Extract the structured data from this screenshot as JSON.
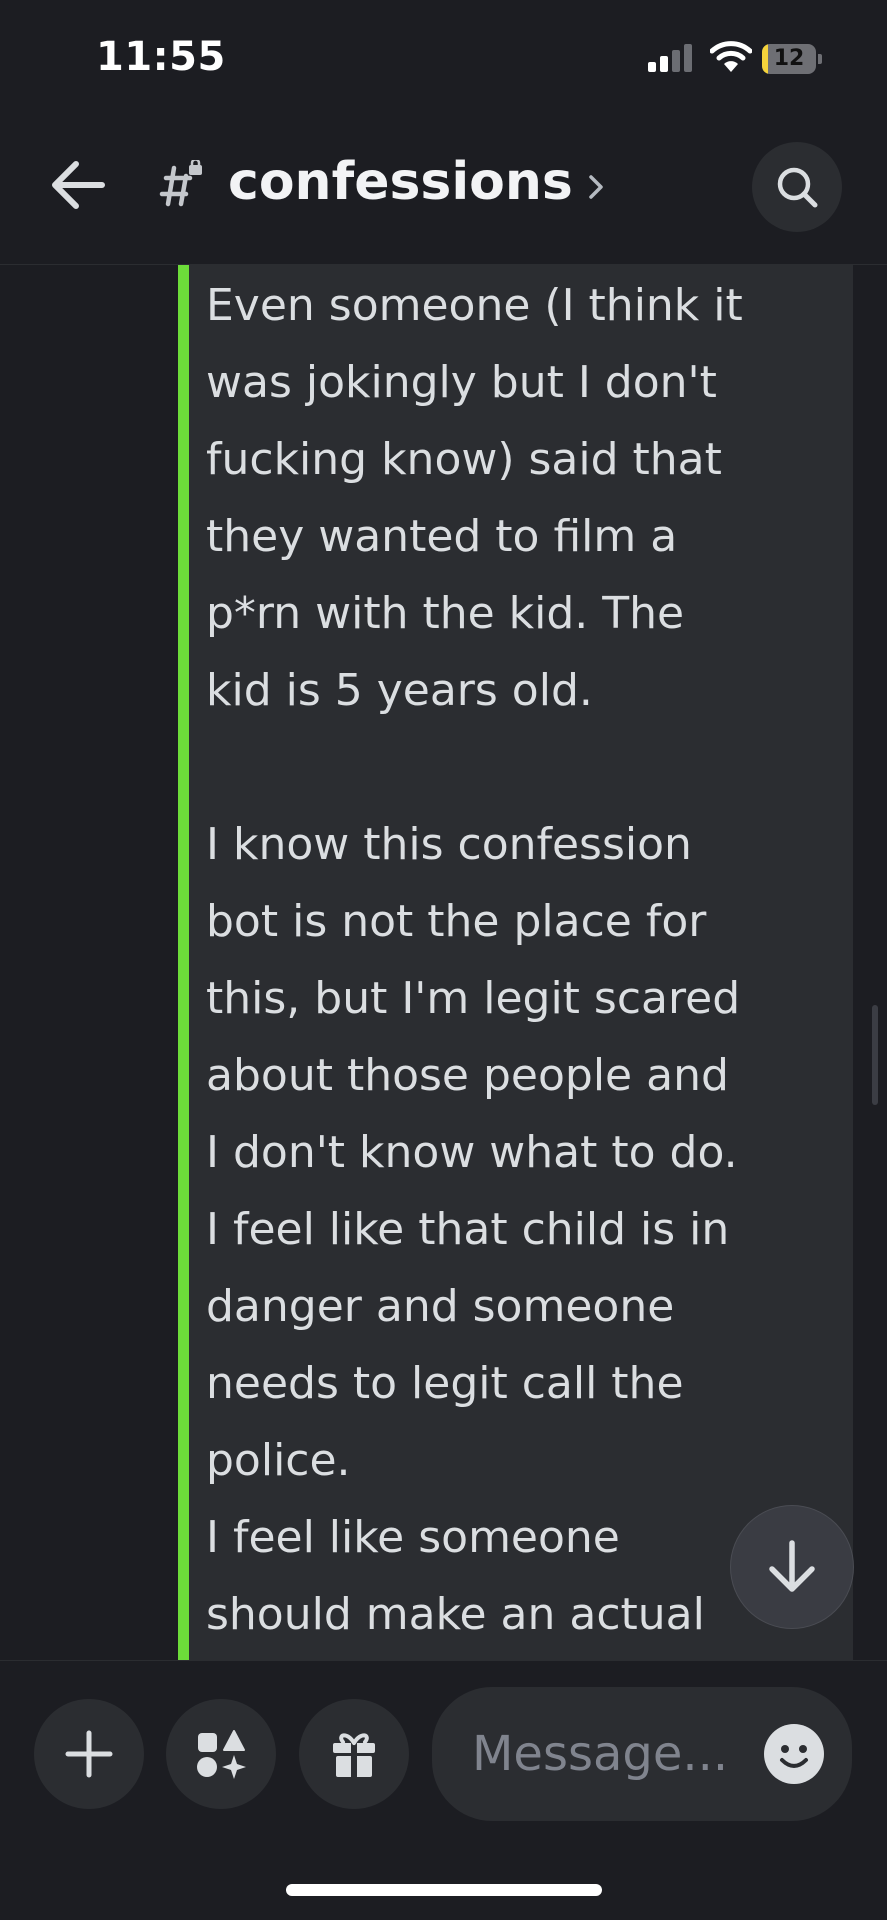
{
  "status_bar": {
    "time": "11:55",
    "battery": "12"
  },
  "header": {
    "channel_name": "confessions"
  },
  "message": {
    "text": "Even someone (I think it\nwas jokingly but I don't\nfucking know) said that\nthey wanted to film a\np*rn with the kid. The\nkid is 5 years old.\n\nI know this confession\nbot is not the place for\nthis, but I'm legit scared\nabout those people and\nI don't know what to do.\nI feel like that child is in\ndanger and someone\nneeds to legit call the\npolice.\nI feel like someone\nshould make an actual"
  },
  "composer": {
    "placeholder": "Message..."
  },
  "colors": {
    "accent_bar": "#6ddc3a",
    "battery_fill": "#f5d33b",
    "background": "#1c1d22",
    "embed": "#2b2d31"
  },
  "icons": [
    "back-arrow-icon",
    "channel-hash-lock-icon",
    "chevron-right-icon",
    "search-icon",
    "arrow-down-icon",
    "plus-icon",
    "apps-icon",
    "gift-icon",
    "emoji-icon",
    "signal-icon",
    "wifi-icon",
    "battery-icon"
  ]
}
